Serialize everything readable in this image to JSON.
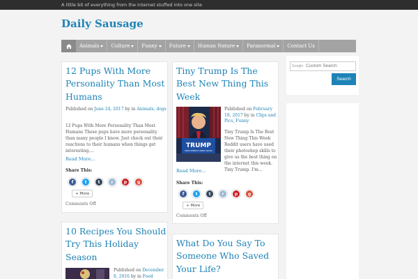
{
  "header": {
    "tagline": "A little bit of everything from the internet stuffed into one site",
    "site_title": "Daily Sausage"
  },
  "nav": {
    "home_icon": "home-icon",
    "items": [
      {
        "label": "Animals",
        "has_dropdown": true
      },
      {
        "label": "Culture",
        "has_dropdown": true
      },
      {
        "label": "Funny",
        "has_dropdown": true
      },
      {
        "label": "Future",
        "has_dropdown": true
      },
      {
        "label": "Human Nature",
        "has_dropdown": true
      },
      {
        "label": "Paranormal",
        "has_dropdown": true
      },
      {
        "label": "Contact Us",
        "has_dropdown": false
      }
    ]
  },
  "posts": [
    {
      "title": "12 Pups With More Personality Than Most Humans",
      "meta_prefix": "Published on",
      "date": "June 24, 2017",
      "meta_in": "by in",
      "categories": "Animals, dogs",
      "excerpt": "12 Pups With More Personality Than Most Humans These pups have more personality than many people I know. Just check out their reactions to their humans when things get interesting....",
      "read_more": "Read More...",
      "share_label": "Share This:",
      "more_label": "More",
      "comments": "Comments Off"
    },
    {
      "title": "Tiny Trump Is The Best New Thing This Week",
      "meta_prefix": "Published on",
      "date": "February 18, 2017",
      "meta_in": "by in",
      "categories": "Clips and Pics, Funny",
      "excerpt": "Tiny Trump Is The Best New Thing This Week Reddit users have used their photoshop skills to give us the best thing on the internet this week. Tiny Trump. I'm...",
      "read_more": "Read More...",
      "share_label": "Share This:",
      "more_label": "More",
      "comments": "Comments Off",
      "image_sign": "TRUMP",
      "image_sign_sub": "MAKE AMERICA GREAT AGAIN!"
    },
    {
      "title": "10 Recipes You Should Try This Holiday Season",
      "meta_prefix": "Published on",
      "date": "December 8, 2016",
      "meta_in": "by in",
      "categories": "Food"
    },
    {
      "title": "What Do You Say To Someone Who Saved Your Life?"
    }
  ],
  "share_icons": [
    "facebook-icon",
    "twitter-icon",
    "tumblr-icon",
    "reddit-icon",
    "pinterest-icon",
    "google-plus-icon"
  ],
  "colors": {
    "accent": "#1e83b6",
    "nav_bg": "#a3a3a3",
    "topbar_bg": "#2e2e2e",
    "facebook": "#3b5998",
    "twitter": "#1da1f2",
    "tumblr": "#35465c",
    "reddit": "#9bb8d6",
    "pinterest": "#cb2027",
    "google_plus": "#dd4b39"
  },
  "sidebar": {
    "search_brand": "Google",
    "search_placeholder": "Custom Search",
    "search_button": "Search"
  }
}
